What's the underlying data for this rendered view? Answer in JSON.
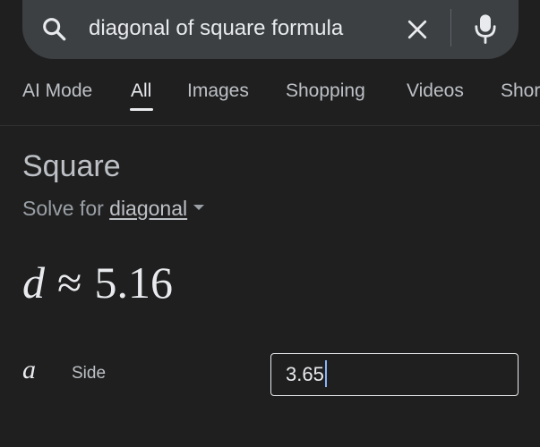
{
  "search": {
    "query": "diagonal of square formula"
  },
  "tabs": [
    {
      "label": "AI Mode"
    },
    {
      "label": "All"
    },
    {
      "label": "Images"
    },
    {
      "label": "Shopping"
    },
    {
      "label": "Videos"
    },
    {
      "label": "Shor"
    }
  ],
  "calculator": {
    "title": "Square",
    "solve_for_prefix": "Solve for",
    "solve_for_variable": "diagonal",
    "result_variable": "d",
    "result_operator": "≈",
    "result_value": "5.16",
    "input_variable": "a",
    "input_label": "Side",
    "input_value": "3.65"
  },
  "colors": {
    "background": "#1f1f1f",
    "search_bar": "#3c4043",
    "cursor": "#8ab4f8"
  },
  "icons": {
    "search": "search-icon",
    "clear": "close-icon",
    "voice": "microphone-icon",
    "dropdown": "chevron-down-icon"
  }
}
